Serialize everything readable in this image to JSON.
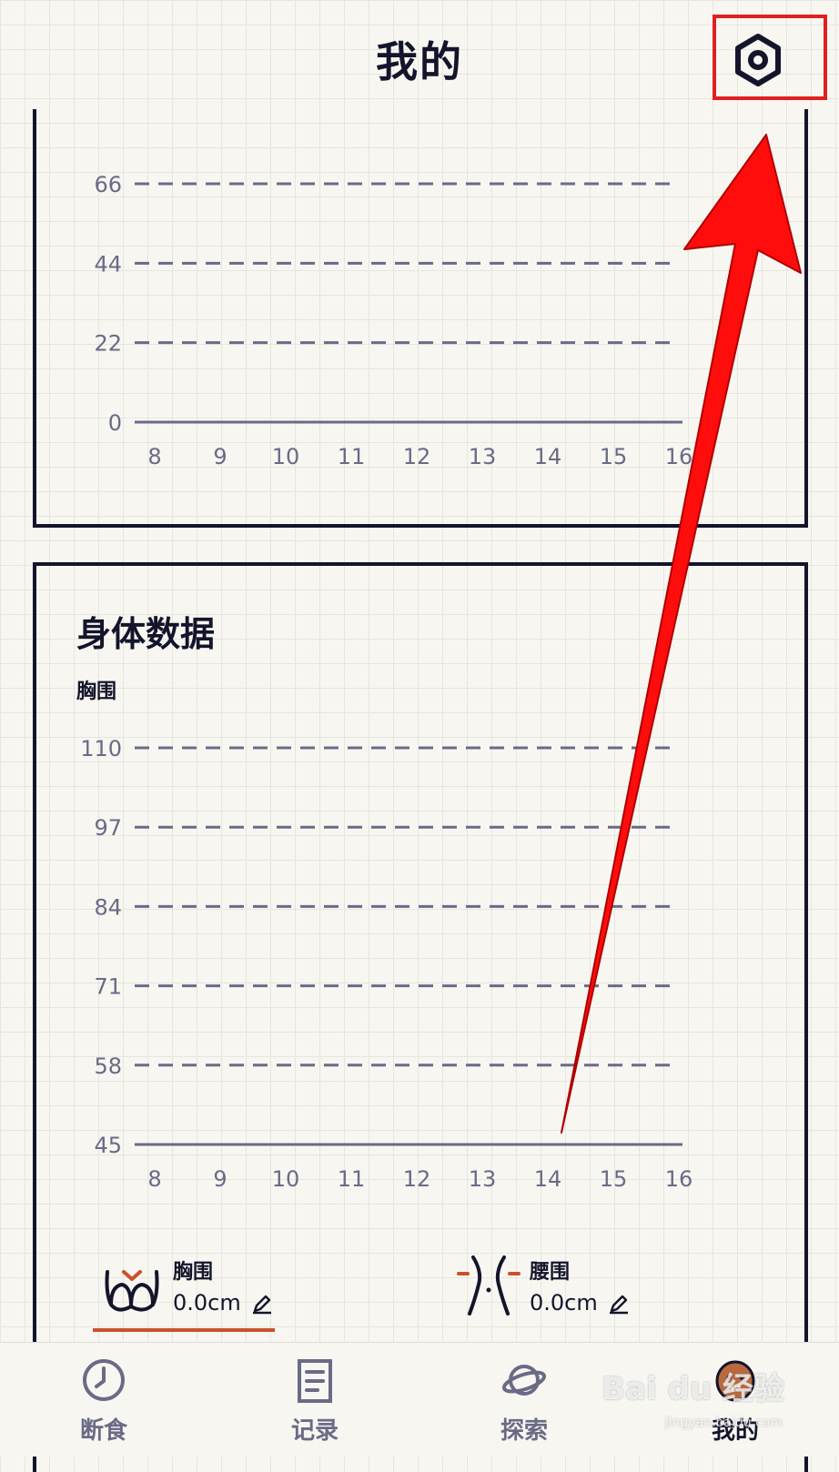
{
  "header": {
    "title": "我的"
  },
  "colors": {
    "ink": "#14142b",
    "muted": "#6b6a86",
    "accent": "#c9512e",
    "highlight": "#e02020"
  },
  "icons": {
    "settings": "gear-icon",
    "bust": "bust-icon",
    "waist": "waist-icon",
    "edit": "pencil-icon",
    "tab_fasting": "clock-icon",
    "tab_records": "notepad-icon",
    "tab_explore": "planet-icon",
    "tab_mine": "avatar-icon"
  },
  "chart_data": [
    {
      "type": "line",
      "x": [
        8,
        9,
        10,
        11,
        12,
        13,
        14,
        15,
        16
      ],
      "yticks": [
        0,
        22,
        44,
        66
      ],
      "ylim": [
        0,
        66
      ],
      "grid": true,
      "series": []
    },
    {
      "type": "line",
      "ylabel": "胸围",
      "x": [
        8,
        9,
        10,
        11,
        12,
        13,
        14,
        15,
        16
      ],
      "yticks": [
        45,
        58,
        71,
        84,
        97,
        110
      ],
      "ylim": [
        45,
        110
      ],
      "grid": true,
      "series": []
    }
  ],
  "body_data": {
    "title": "身体数据",
    "chart_label": "胸围",
    "metrics": [
      {
        "name": "胸围",
        "value": "0.0cm",
        "selected": true
      },
      {
        "name": "腰围",
        "value": "0.0cm",
        "selected": false
      }
    ]
  },
  "tabs": [
    {
      "label": "断食",
      "active": false
    },
    {
      "label": "记录",
      "active": false
    },
    {
      "label": "探索",
      "active": false
    },
    {
      "label": "我的",
      "active": true
    }
  ],
  "watermark": {
    "brand": "Bai du 经验",
    "url": "jingyan.baidu.com"
  }
}
